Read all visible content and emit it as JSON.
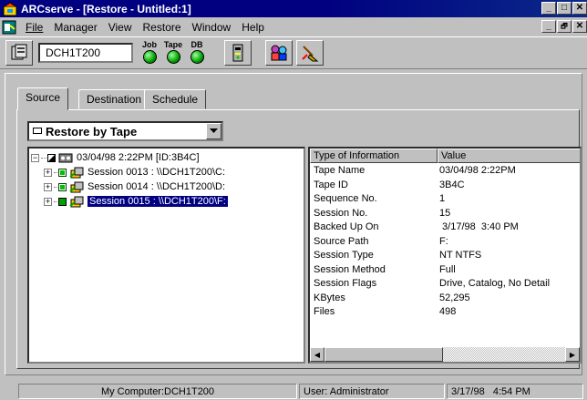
{
  "window": {
    "title": "ARCserve - [Restore - Untitled:1]",
    "controls": [
      "_",
      "□",
      "✕"
    ],
    "mdi_controls": [
      "_",
      "🗗",
      "✕"
    ]
  },
  "menu": {
    "items": [
      {
        "label": "File"
      },
      {
        "label": "Manager"
      },
      {
        "label": "View"
      },
      {
        "label": "Restore"
      },
      {
        "label": "Window"
      },
      {
        "label": "Help"
      }
    ]
  },
  "toolbar": {
    "server_name": "DCH1T200",
    "status_labels": [
      "Job",
      "Tape",
      "DB"
    ]
  },
  "tabs": [
    {
      "label": "Source"
    },
    {
      "label": "Destination"
    },
    {
      "label": "Schedule"
    }
  ],
  "restore_mode": {
    "selected": "Restore by Tape"
  },
  "tree": {
    "root": "03/04/98 2:22PM [ID:3B4C]",
    "sessions": [
      {
        "label": "Session 0013 : \\\\DCH1T200\\C:"
      },
      {
        "label": "Session 0014 : \\\\DCH1T200\\D:"
      },
      {
        "label": "Session 0015 : \\\\DCH1T200\\F:"
      }
    ]
  },
  "info_table": {
    "headers": [
      "Type of Information",
      "Value"
    ],
    "rows": [
      {
        "key": "Tape Name",
        "value": "03/04/98 2:22PM"
      },
      {
        "key": "Tape ID",
        "value": "3B4C"
      },
      {
        "key": "Sequence No.",
        "value": "1"
      },
      {
        "key": "Session No.",
        "value": "15"
      },
      {
        "key": "Backed Up On",
        "value": " 3/17/98  3:40 PM"
      },
      {
        "key": "Source Path",
        "value": "F:"
      },
      {
        "key": "Session Type",
        "value": "NT NTFS"
      },
      {
        "key": "Session Method",
        "value": "Full"
      },
      {
        "key": "Session Flags",
        "value": "Drive, Catalog, No Detail"
      },
      {
        "key": "KBytes",
        "value": "52,295"
      },
      {
        "key": "Files",
        "value": "498"
      }
    ]
  },
  "statusbar": {
    "computer": "My Computer:DCH1T200",
    "user": "User: Administrator",
    "datetime": "3/17/98   4:54 PM"
  }
}
